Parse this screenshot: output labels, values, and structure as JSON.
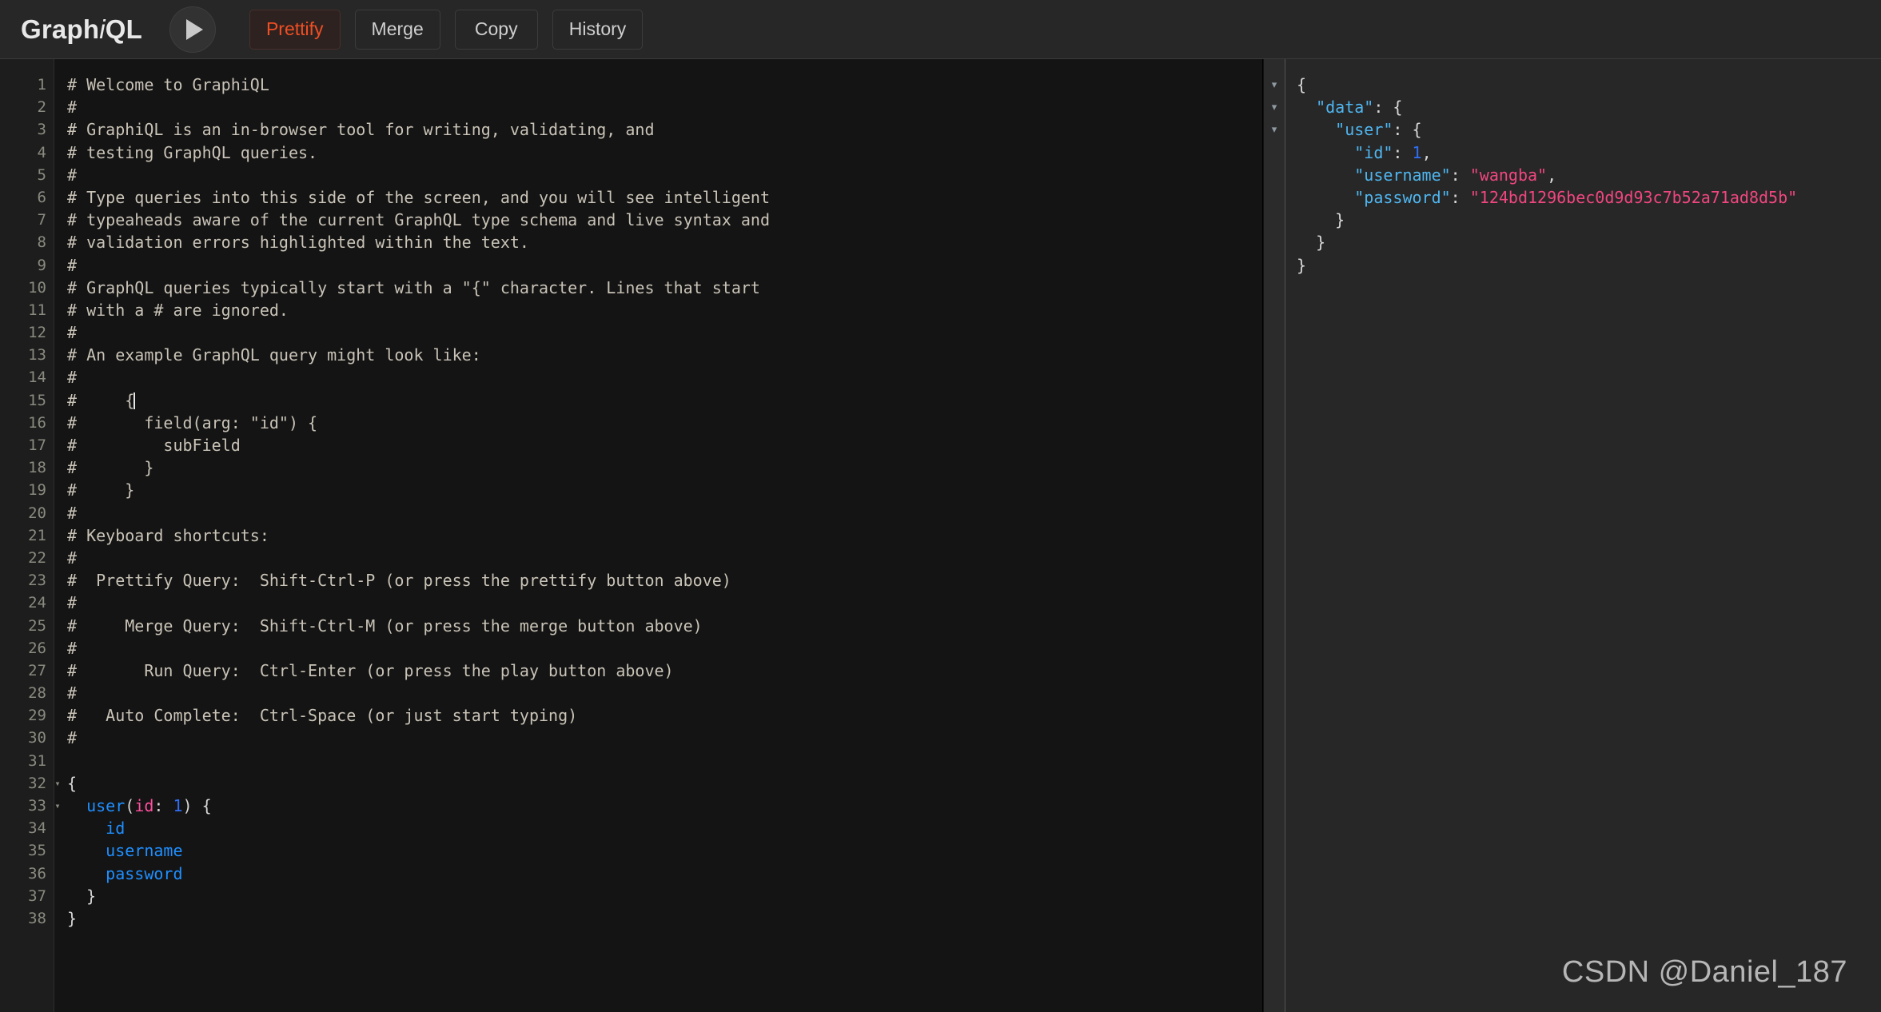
{
  "app": {
    "brand_prefix": "Graph",
    "brand_italic": "i",
    "brand_suffix": "QL"
  },
  "toolbar": {
    "execute_label": "",
    "buttons": [
      {
        "name": "prettify",
        "label": "Prettify"
      },
      {
        "name": "merge",
        "label": "Merge"
      },
      {
        "name": "copy",
        "label": "Copy"
      },
      {
        "name": "history",
        "label": "History"
      }
    ],
    "accent_color": "#f04e23"
  },
  "query_editor": {
    "line_numbers": [
      1,
      2,
      3,
      4,
      5,
      6,
      7,
      8,
      9,
      10,
      11,
      12,
      13,
      14,
      15,
      16,
      17,
      18,
      19,
      20,
      21,
      22,
      23,
      24,
      25,
      26,
      27,
      28,
      29,
      30,
      31,
      32,
      33,
      34,
      35,
      36,
      37,
      38
    ],
    "fold_lines": [
      32,
      33
    ],
    "lines": [
      "# Welcome to GraphiQL",
      "#",
      "# GraphiQL is an in-browser tool for writing, validating, and",
      "# testing GraphQL queries.",
      "#",
      "# Type queries into this side of the screen, and you will see intelligent",
      "# typeaheads aware of the current GraphQL type schema and live syntax and",
      "# validation errors highlighted within the text.",
      "#",
      "# GraphQL queries typically start with a \"{\" character. Lines that start",
      "# with a # are ignored.",
      "#",
      "# An example GraphQL query might look like:",
      "#",
      "#     {",
      "#       field(arg: \"id\") {",
      "#         subField",
      "#       }",
      "#     }",
      "#",
      "# Keyboard shortcuts:",
      "#",
      "#  Prettify Query:  Shift-Ctrl-P (or press the prettify button above)",
      "#",
      "#     Merge Query:  Shift-Ctrl-M (or press the merge button above)",
      "#",
      "#       Run Query:  Ctrl-Enter (or press the play button above)",
      "#",
      "#   Auto Complete:  Ctrl-Space (or just start typing)",
      "#",
      "",
      "{",
      "  user(id: 1) {",
      "    id",
      "    username",
      "    password",
      "  }",
      "}"
    ],
    "cursor_line": 15,
    "query": {
      "open_brace": "{",
      "field_name": "user",
      "arg_name": "id",
      "arg_value": "1",
      "selection_fields": [
        "id",
        "username",
        "password"
      ],
      "close_brace_inner": "}",
      "close_brace_outer": "}"
    }
  },
  "result_viewer": {
    "fold_markers": 3,
    "lines": [
      {
        "indent": 0,
        "tokens": [
          {
            "t": "punct",
            "v": "{"
          }
        ]
      },
      {
        "indent": 1,
        "tokens": [
          {
            "t": "key",
            "v": "\"data\""
          },
          {
            "t": "punct",
            "v": ": {"
          }
        ]
      },
      {
        "indent": 2,
        "tokens": [
          {
            "t": "key",
            "v": "\"user\""
          },
          {
            "t": "punct",
            "v": ": {"
          }
        ]
      },
      {
        "indent": 3,
        "tokens": [
          {
            "t": "key",
            "v": "\"id\""
          },
          {
            "t": "punct",
            "v": ": "
          },
          {
            "t": "num",
            "v": "1"
          },
          {
            "t": "punct",
            "v": ","
          }
        ]
      },
      {
        "indent": 3,
        "tokens": [
          {
            "t": "key",
            "v": "\"username\""
          },
          {
            "t": "punct",
            "v": ": "
          },
          {
            "t": "str",
            "v": "\"wangba\""
          },
          {
            "t": "punct",
            "v": ","
          }
        ]
      },
      {
        "indent": 3,
        "tokens": [
          {
            "t": "key",
            "v": "\"password\""
          },
          {
            "t": "punct",
            "v": ": "
          },
          {
            "t": "str",
            "v": "\"124bd1296bec0d9d93c7b52a71ad8d5b\""
          }
        ]
      },
      {
        "indent": 2,
        "tokens": [
          {
            "t": "punct",
            "v": "}"
          }
        ]
      },
      {
        "indent": 1,
        "tokens": [
          {
            "t": "punct",
            "v": "}"
          }
        ]
      },
      {
        "indent": 0,
        "tokens": [
          {
            "t": "punct",
            "v": "}"
          }
        ]
      }
    ],
    "data_key": "data",
    "user_key": "user",
    "user": {
      "id": 1,
      "username": "wangba",
      "password": "124bd1296bec0d9d93c7b52a71ad8d5b"
    }
  },
  "watermark": {
    "text": "CSDN @Daniel_187"
  }
}
